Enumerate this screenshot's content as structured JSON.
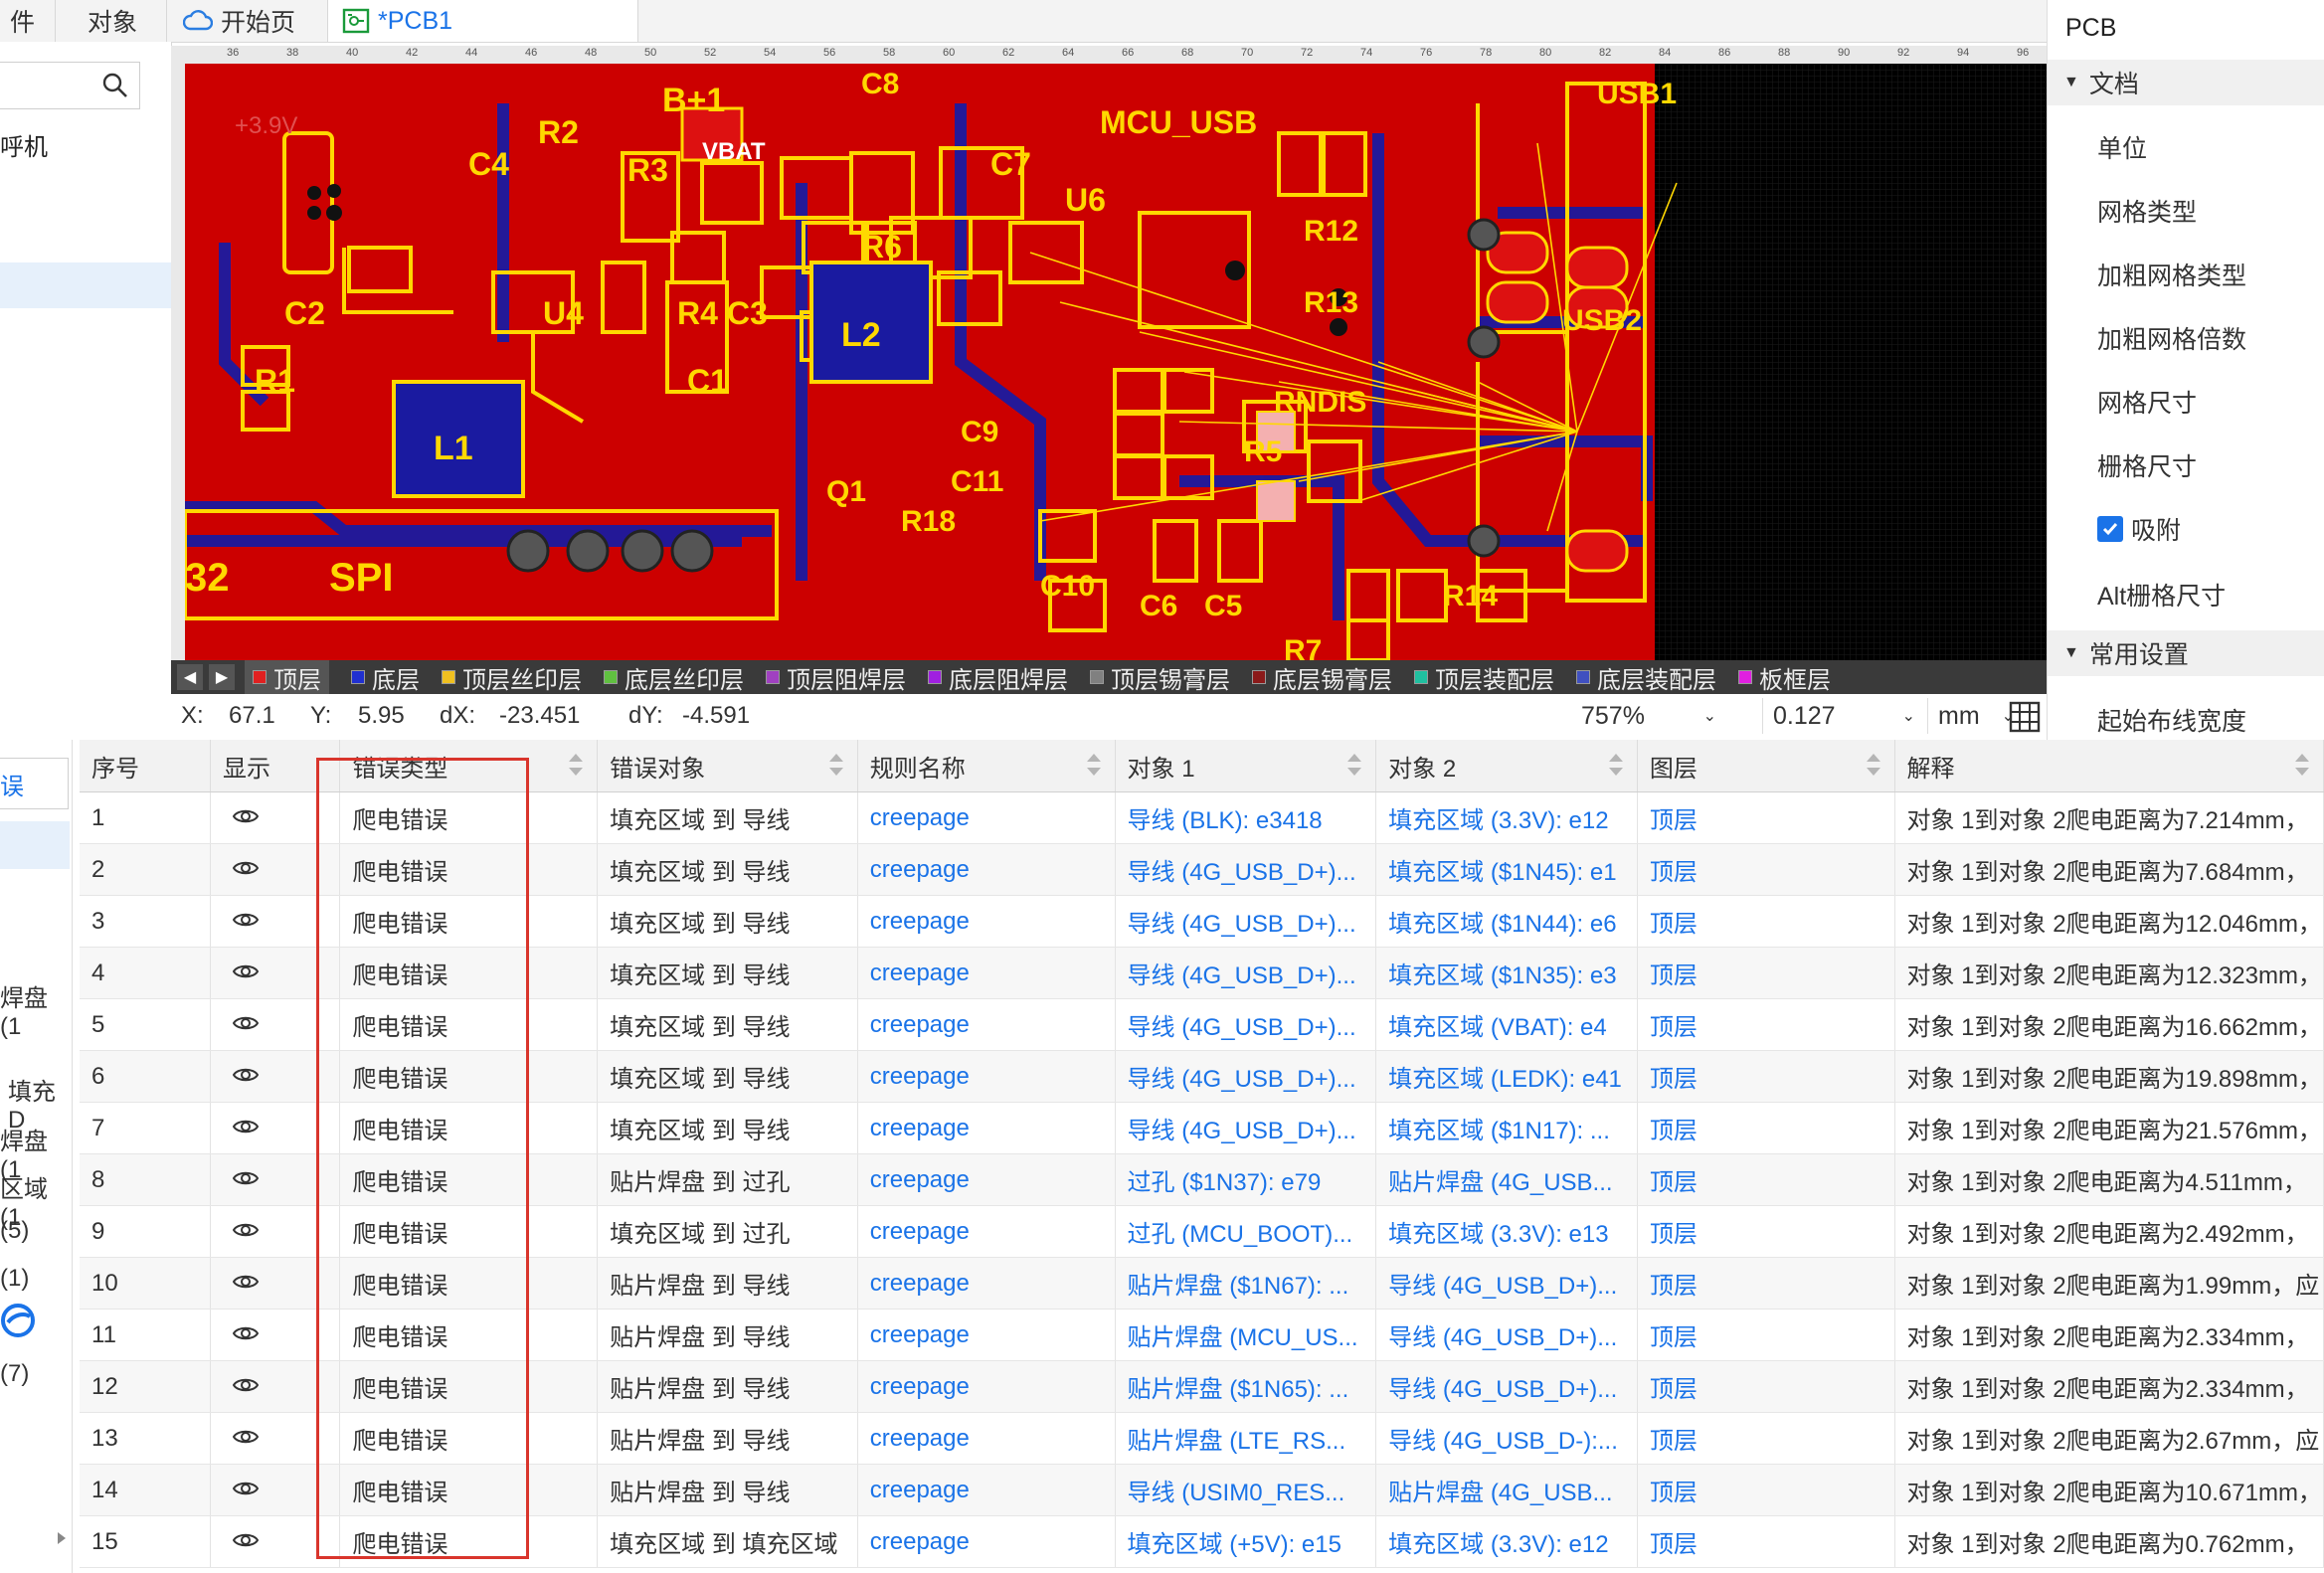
{
  "tabs": [
    {
      "label": "件"
    },
    {
      "label": "对象"
    },
    {
      "label": "开始页",
      "icon": "cloud-icon"
    },
    {
      "label": "*PCB1",
      "icon": "pcb-icon"
    }
  ],
  "left_panel": {
    "items": [
      "呼机"
    ],
    "lower_items": [
      "误",
      "焊盘 (1",
      "填充D",
      "焊盘 (1",
      "区域 (1",
      "(5)",
      "(1)",
      "(7)"
    ]
  },
  "ruler": {
    "ticks": [
      "36",
      "38",
      "40",
      "42",
      "44",
      "46",
      "48",
      "50",
      "52",
      "54",
      "56",
      "58",
      "60",
      "62",
      "64",
      "66",
      "68",
      "70",
      "72",
      "74",
      "76",
      "78",
      "80",
      "82",
      "84",
      "86",
      "88",
      "90",
      "92",
      "94",
      "96"
    ]
  },
  "pcb": {
    "labels": [
      "B+1",
      "VBAT",
      "C8",
      "MCU_USB",
      "USB1",
      "R2",
      "C4",
      "R3",
      "C7",
      "U6",
      "R6",
      "R12",
      "C2",
      "U4",
      "R4",
      "C3",
      "L2",
      "R13",
      "USB2",
      "R1",
      "L1",
      "C1",
      "RNDIS",
      "C9",
      "R5",
      "C11",
      "Q1",
      "R18",
      "SPI",
      "C10",
      "C6",
      "C5",
      "R14",
      "R7",
      "32",
      "+3.9V"
    ],
    "colors": {
      "copper": "#cc0000",
      "silk": "#ffd800",
      "bottom": "#1a1aa0",
      "bg": "#000000"
    }
  },
  "layers": [
    {
      "name": "顶层",
      "color": "#e02020",
      "active": true
    },
    {
      "name": "底层",
      "color": "#2030d0"
    },
    {
      "name": "顶层丝印层",
      "color": "#f0c020"
    },
    {
      "name": "底层丝印层",
      "color": "#60c040"
    },
    {
      "name": "顶层阻焊层",
      "color": "#a040c0"
    },
    {
      "name": "底层阻焊层",
      "color": "#a020e0"
    },
    {
      "name": "顶层锡膏层",
      "color": "#808080"
    },
    {
      "name": "底层锡膏层",
      "color": "#8b1a1a"
    },
    {
      "name": "顶层装配层",
      "color": "#20c0a0"
    },
    {
      "name": "底层装配层",
      "color": "#4050c0"
    },
    {
      "name": "板框层",
      "color": "#e020e0"
    }
  ],
  "status": {
    "x_label": "X:",
    "x": "67.1",
    "y_label": "Y:",
    "y": "5.95",
    "dx_label": "dX:",
    "dx": "-23.451",
    "dy_label": "dY:",
    "dy": "-4.591",
    "zoom": "757%",
    "grid": "0.127",
    "unit": "mm"
  },
  "right_panel": {
    "title": "PCB",
    "section1": "文档",
    "items": [
      "单位",
      "网格类型",
      "加粗网格类型",
      "加粗网格倍数",
      "网格尺寸",
      "栅格尺寸"
    ],
    "snap_label": "吸附",
    "snap_checked": true,
    "alt_grid": "Alt栅格尺寸",
    "section2": "常用设置",
    "route_width": "起始布线宽度"
  },
  "table": {
    "headers": [
      "序号",
      "显示",
      "错误类型",
      "错误对象",
      "规则名称",
      "对象 1",
      "对象 2",
      "图层",
      "解释"
    ],
    "rows": [
      [
        "1",
        "爬电错误",
        "填充区域 到 导线",
        "creepage",
        "导线 (BLK): e3418",
        "填充区域 (3.3V): e12",
        "顶层",
        "对象 1到对象 2爬电距离为7.214mm，"
      ],
      [
        "2",
        "爬电错误",
        "填充区域 到 导线",
        "creepage",
        "导线 (4G_USB_D+)...",
        "填充区域 ($1N45): e1",
        "顶层",
        "对象 1到对象 2爬电距离为7.684mm，"
      ],
      [
        "3",
        "爬电错误",
        "填充区域 到 导线",
        "creepage",
        "导线 (4G_USB_D+)...",
        "填充区域 ($1N44): e6",
        "顶层",
        "对象 1到对象 2爬电距离为12.046mm，"
      ],
      [
        "4",
        "爬电错误",
        "填充区域 到 导线",
        "creepage",
        "导线 (4G_USB_D+)...",
        "填充区域 ($1N35): e3",
        "顶层",
        "对象 1到对象 2爬电距离为12.323mm，"
      ],
      [
        "5",
        "爬电错误",
        "填充区域 到 导线",
        "creepage",
        "导线 (4G_USB_D+)...",
        "填充区域 (VBAT): e4",
        "顶层",
        "对象 1到对象 2爬电距离为16.662mm，"
      ],
      [
        "6",
        "爬电错误",
        "填充区域 到 导线",
        "creepage",
        "导线 (4G_USB_D+)...",
        "填充区域 (LEDK): e41",
        "顶层",
        "对象 1到对象 2爬电距离为19.898mm，"
      ],
      [
        "7",
        "爬电错误",
        "填充区域 到 导线",
        "creepage",
        "导线 (4G_USB_D+)...",
        "填充区域 ($1N17): ...",
        "顶层",
        "对象 1到对象 2爬电距离为21.576mm，"
      ],
      [
        "8",
        "爬电错误",
        "贴片焊盘 到 过孔",
        "creepage",
        "过孔 ($1N37): e79",
        "贴片焊盘 (4G_USB...",
        "顶层",
        "对象 1到对象 2爬电距离为4.511mm，"
      ],
      [
        "9",
        "爬电错误",
        "填充区域 到 过孔",
        "creepage",
        "过孔 (MCU_BOOT)...",
        "填充区域 (3.3V): e13",
        "顶层",
        "对象 1到对象 2爬电距离为2.492mm，"
      ],
      [
        "10",
        "爬电错误",
        "贴片焊盘 到 导线",
        "creepage",
        "贴片焊盘 ($1N67): ...",
        "导线 (4G_USB_D+)...",
        "顶层",
        "对象 1到对象 2爬电距离为1.99mm，应"
      ],
      [
        "11",
        "爬电错误",
        "贴片焊盘 到 导线",
        "creepage",
        "贴片焊盘 (MCU_US...",
        "导线 (4G_USB_D+)...",
        "顶层",
        "对象 1到对象 2爬电距离为2.334mm，"
      ],
      [
        "12",
        "爬电错误",
        "贴片焊盘 到 导线",
        "creepage",
        "贴片焊盘 ($1N65): ...",
        "导线 (4G_USB_D+)...",
        "顶层",
        "对象 1到对象 2爬电距离为2.334mm，"
      ],
      [
        "13",
        "爬电错误",
        "贴片焊盘 到 导线",
        "creepage",
        "贴片焊盘 (LTE_RS...",
        "导线 (4G_USB_D-):...",
        "顶层",
        "对象 1到对象 2爬电距离为2.67mm，应"
      ],
      [
        "14",
        "爬电错误",
        "贴片焊盘 到 导线",
        "creepage",
        "导线 (USIM0_RES...",
        "贴片焊盘 (4G_USB...",
        "顶层",
        "对象 1到对象 2爬电距离为10.671mm，"
      ],
      [
        "15",
        "爬电错误",
        "填充区域 到 填充区域",
        "creepage",
        "填充区域 (+5V): e15",
        "填充区域 (3.3V): e12",
        "顶层",
        "对象 1到对象 2爬电距离为0.762mm，"
      ]
    ]
  }
}
